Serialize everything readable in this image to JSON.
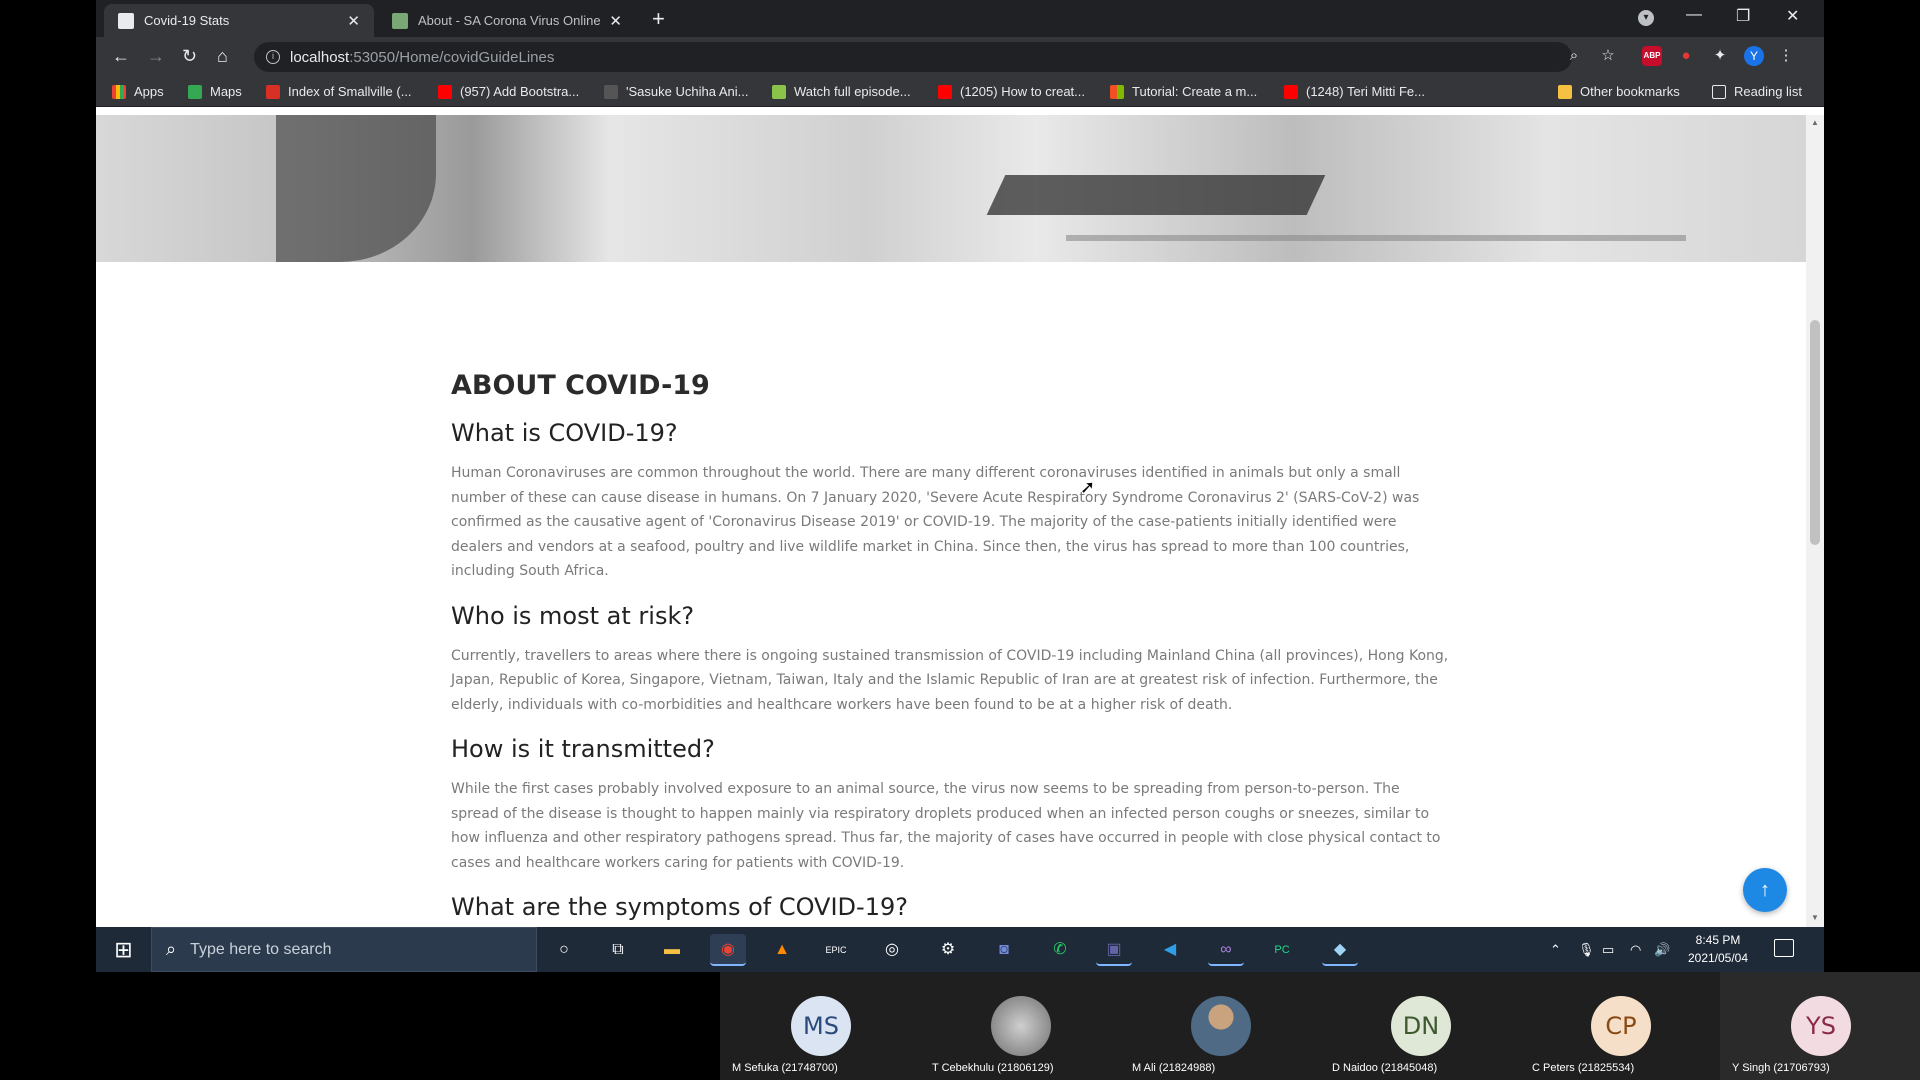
{
  "browser": {
    "tabs": [
      {
        "title": "Covid-19 Stats",
        "active": true
      },
      {
        "title": "About - SA Corona Virus Online",
        "active": false
      }
    ],
    "url_host": "localhost",
    "url_path": ":53050/Home/covidGuideLines",
    "bookmarks": [
      {
        "label": "Apps",
        "icon": "apps-grid-icon"
      },
      {
        "label": "Maps",
        "icon": "maps-icon"
      },
      {
        "label": "Index of Smallville (...",
        "icon": "folder-flag-icon"
      },
      {
        "label": "(957) Add Bootstra...",
        "icon": "youtube-icon"
      },
      {
        "label": "'Sasuke Uchiha Ani...",
        "icon": "anime-icon"
      },
      {
        "label": "Watch full episode...",
        "icon": "video-site-icon"
      },
      {
        "label": "(1205) How to creat...",
        "icon": "youtube-icon"
      },
      {
        "label": "Tutorial: Create a m...",
        "icon": "microsoft-icon"
      },
      {
        "label": "(1248) Teri Mitti Fe...",
        "icon": "youtube-icon"
      },
      {
        "label": "Other bookmarks",
        "icon": "folder-icon"
      },
      {
        "label": "Reading list",
        "icon": "reading-list-icon"
      }
    ],
    "profile_initial": "Y",
    "abp_label": "ABP"
  },
  "page": {
    "heading": "ABOUT COVID-19",
    "sections": [
      {
        "title": "What is COVID-19?",
        "body": "Human Coronaviruses are common throughout the world. There are many different coronaviruses identified in animals but only a small number of these can cause disease in humans. On 7 January 2020, 'Severe Acute Respiratory Syndrome Coronavirus 2' (SARS-CoV-2) was confirmed as the causative agent of 'Coronavirus Disease 2019' or COVID-19. The majority of the case-patients initially identified were dealers and vendors at a seafood, poultry and live wildlife market in China. Since then, the virus has spread to more than 100 countries, including South Africa."
      },
      {
        "title": "Who is most at risk?",
        "body": "Currently, travellers to areas where there is ongoing sustained transmission of COVID-19 including Mainland China (all provinces), Hong Kong, Japan, Republic of Korea, Singapore, Vietnam, Taiwan, Italy and the Islamic Republic of Iran are at greatest risk of infection. Furthermore, the elderly, individuals with co-morbidities and healthcare workers have been found to be at a higher risk of death."
      },
      {
        "title": "How is it transmitted?",
        "body": "While the first cases probably involved exposure to an animal source, the virus now seems to be spreading from person-to-person. The spread of the disease is thought to happen mainly via respiratory droplets produced when an infected person coughs or sneezes, similar to how influenza and other respiratory pathogens spread. Thus far, the majority of cases have occurred in people with close physical contact to cases and healthcare workers caring for patients with COVID-19."
      }
    ],
    "next_section_partial": "What are the symptoms of COVID-19?",
    "fab_icon": "arrow-up-icon"
  },
  "taskbar": {
    "search_placeholder": "Type here to search",
    "time": "8:45 PM",
    "date": "2021/05/04"
  },
  "meeting": {
    "participants": [
      {
        "initials": "MS",
        "name": "M Sefuka (21748700)",
        "bg": "#dbe4f3",
        "fg": "#2b4a7a"
      },
      {
        "initials": "",
        "name": "T Cebekhulu (21806129)",
        "bg": "#9a9a9a",
        "fg": "#ffffff"
      },
      {
        "initials": "",
        "name": "M Ali (21824988)",
        "bg": "#6f7f8f",
        "fg": "#ffffff"
      },
      {
        "initials": "DN",
        "name": "D Naidoo (21845048)",
        "bg": "#dfe8d6",
        "fg": "#3d5a2e"
      },
      {
        "initials": "CP",
        "name": "C Peters (21825534)",
        "bg": "#f6dfc8",
        "fg": "#8a4a14"
      },
      {
        "initials": "YS",
        "name": "Y Singh (21706793)",
        "bg": "#f3dbe2",
        "fg": "#8a2a4a"
      }
    ]
  }
}
